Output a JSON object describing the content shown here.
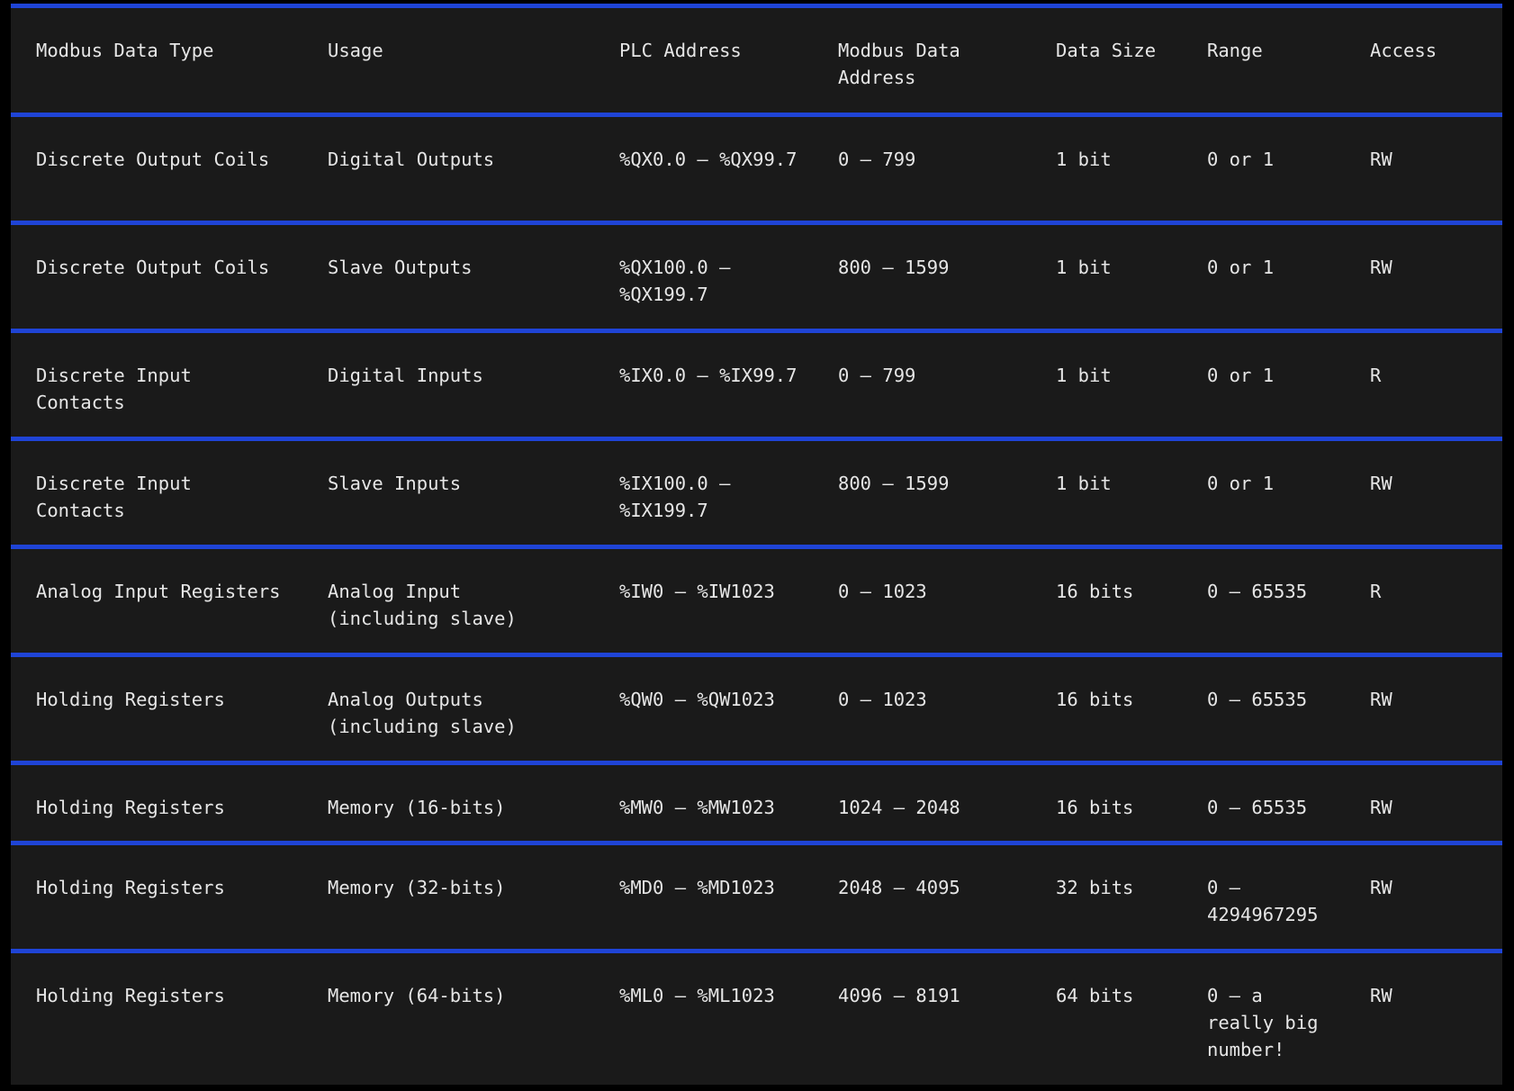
{
  "table": {
    "headers": [
      "Modbus Data Type",
      "Usage",
      "PLC Address",
      "Modbus Data Address",
      "Data Size",
      "Range",
      "Access"
    ],
    "rows": [
      [
        "Discrete Output Coils",
        "Digital Outputs",
        "%QX0.0 – %QX99.7",
        "0 – 799",
        "1 bit",
        "0 or 1",
        "RW"
      ],
      [
        "Discrete Output Coils",
        "Slave Outputs",
        "%QX100.0 – %QX199.7",
        "800 – 1599",
        "1 bit",
        "0 or 1",
        "RW"
      ],
      [
        "Discrete Input Contacts",
        "Digital Inputs",
        "%IX0.0 – %IX99.7",
        "0 – 799",
        "1 bit",
        "0 or 1",
        "R"
      ],
      [
        "Discrete Input Contacts",
        "Slave Inputs",
        "%IX100.0 – %IX199.7",
        "800 – 1599",
        "1 bit",
        "0 or 1",
        "RW"
      ],
      [
        "Analog Input Registers",
        "Analog Input (including slave)",
        "%IW0 – %IW1023",
        "0 – 1023",
        "16 bits",
        "0 – 65535",
        "R"
      ],
      [
        "Holding Registers",
        "Analog Outputs (including slave)",
        "%QW0 – %QW1023",
        "0 – 1023",
        "16 bits",
        "0 – 65535",
        "RW"
      ],
      [
        "Holding Registers",
        "Memory (16-bits)",
        "%MW0 – %MW1023",
        "1024 – 2048",
        "16 bits",
        "0 – 65535",
        "RW"
      ],
      [
        "Holding Registers",
        "Memory (32-bits)",
        "%MD0 – %MD1023",
        "2048 – 4095",
        "32 bits",
        "0 – 4294967295",
        "RW"
      ],
      [
        "Holding Registers",
        "Memory (64-bits)",
        "%ML0 – %ML1023",
        "4096 – 8191",
        "64 bits",
        "0 – a really big number!",
        "RW"
      ]
    ]
  },
  "colors": {
    "background": "#1a1a1a",
    "page": "#000000",
    "divider": "#1f44d6",
    "text": "#e6e6e6"
  }
}
